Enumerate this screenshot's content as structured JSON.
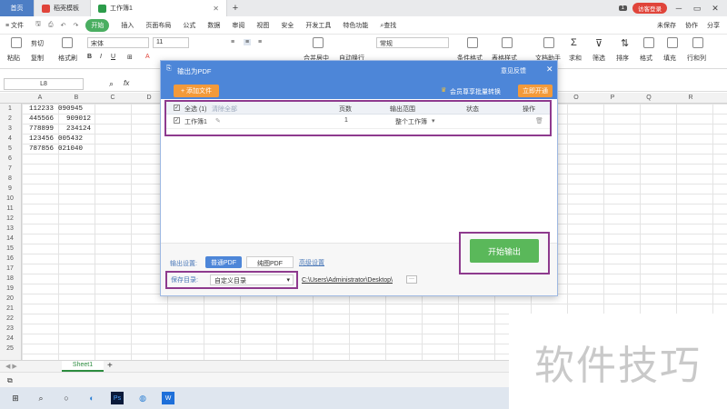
{
  "titlebar": {
    "home": "首页",
    "tab1": "稻壳模板",
    "tab2": "工作簿1",
    "new_tab": "+",
    "badge": "1",
    "visitor": "访客登录",
    "win_min": "─",
    "win_max": "▭",
    "win_close": "✕"
  },
  "menubar": {
    "file": "≡ 文件",
    "start": "开始",
    "items": [
      "插入",
      "页面布局",
      "公式",
      "数据",
      "审阅",
      "视图",
      "安全",
      "开发工具",
      "特色功能"
    ],
    "search": "查找",
    "unsaved": "未保存",
    "collab": "协作",
    "share": "分享"
  },
  "ribbon": {
    "paste": "粘贴",
    "cut": "剪切",
    "copy": "复制",
    "format_painter": "格式刷",
    "font": "宋体",
    "font_size": "11",
    "merge": "合并居中",
    "wrap": "自动换行",
    "number_format": "常规",
    "cond_format": "条件格式",
    "table_style": "表格样式",
    "doc_helper": "文档助手",
    "sum": "求和",
    "filter": "筛选",
    "sort": "排序",
    "format": "格式",
    "fill": "填充",
    "rowcol": "行和列"
  },
  "formula": {
    "namebox": "L8",
    "fx": "fx"
  },
  "grid": {
    "columns": [
      "A",
      "B",
      "C",
      "D",
      "O",
      "P",
      "Q",
      "R"
    ],
    "rows": [
      "1",
      "2",
      "3",
      "4",
      "5",
      "6",
      "7",
      "8",
      "9",
      "10",
      "11",
      "12",
      "13",
      "14",
      "15",
      "16",
      "17",
      "18",
      "19",
      "20",
      "21",
      "22",
      "23",
      "24",
      "25"
    ],
    "cells": [
      {
        "row": 1,
        "a": "112233",
        "b": "090945"
      },
      {
        "row": 2,
        "a": "445566",
        "b": "909012"
      },
      {
        "row": 3,
        "a": "778899",
        "b": "234124"
      },
      {
        "row": 4,
        "a": "123456",
        "b": "005432"
      },
      {
        "row": 5,
        "a": "787856",
        "b": "021040"
      }
    ]
  },
  "sheets": {
    "active": "Sheet1",
    "add": "+"
  },
  "dialog": {
    "title": "输出为PDF",
    "feedback": "意见反馈",
    "close": "✕",
    "add_file": "+ 添加文件",
    "member_convert": "会员尊享批量转换",
    "open_now": "立即开通",
    "table": {
      "select_all": "全选 (1)",
      "clear_all": "清除全部",
      "col_pages": "页数",
      "col_range": "输出范围",
      "col_status": "状态",
      "col_action": "操作",
      "row_name": "工作簿1",
      "row_pages": "1",
      "row_range": "整个工作簿"
    },
    "output_settings_label": "输出设置:",
    "normal_pdf": "普通PDF",
    "image_pdf": "纯图PDF",
    "advanced": "高级设置",
    "save_dir_label": "保存目录:",
    "save_dir_value": "自定义目录",
    "path": "C:\\Users\\Administrator\\Desktop\\",
    "browse": "···",
    "start_output": "开始输出"
  },
  "taskbar": {
    "start_icon": "windows-logo",
    "search_icon": "search-icon"
  },
  "watermark": "软件技巧"
}
